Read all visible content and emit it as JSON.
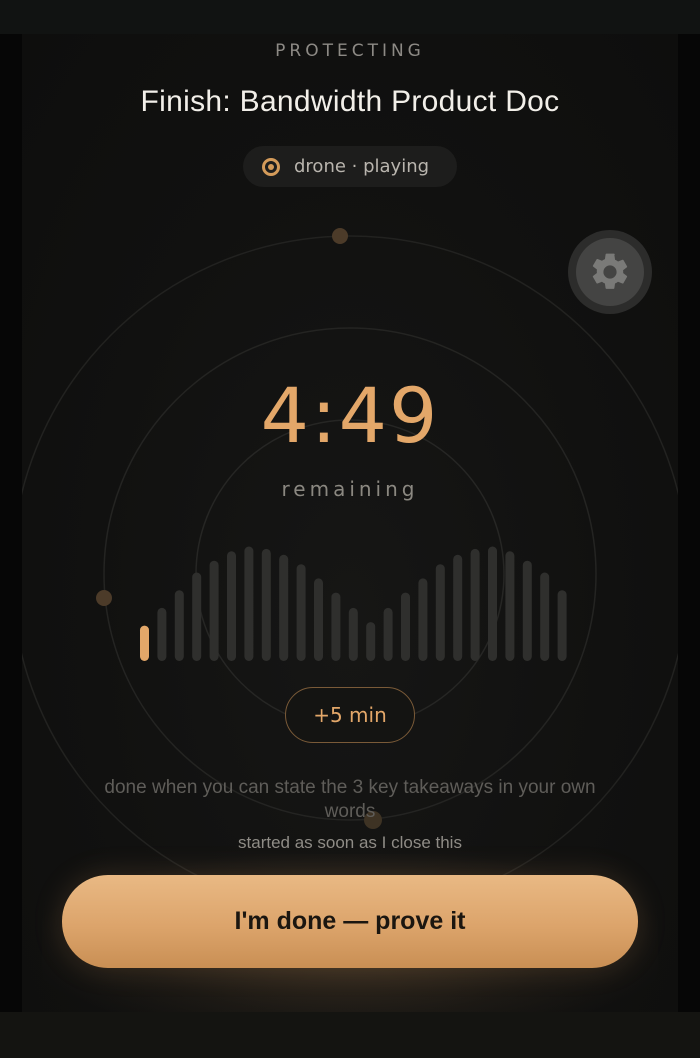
{
  "header": {
    "eyebrow": "PROTECTING",
    "task_title": "Finish: Bandwidth Product Doc"
  },
  "audio": {
    "status": "drone · playing",
    "icon": "radio-dot-icon"
  },
  "settings": {
    "icon": "gear-icon"
  },
  "timer": {
    "value": "4:49",
    "label": "remaining"
  },
  "waveform": {
    "bars": [
      0.3,
      0.45,
      0.6,
      0.75,
      0.85,
      0.93,
      0.97,
      0.95,
      0.9,
      0.82,
      0.7,
      0.58,
      0.45,
      0.33,
      0.45,
      0.58,
      0.7,
      0.82,
      0.9,
      0.95,
      0.97,
      0.93,
      0.85,
      0.75,
      0.6
    ],
    "progress_bars": 1
  },
  "actions": {
    "add_time_label": "+5 min",
    "done_label": "I'm done — prove it"
  },
  "criteria": {
    "done_when": "done when you can state the 3 key takeaways in your own words",
    "start_note": "started as soon as I close this"
  },
  "footer": {
    "partial_text": "· ·  · ·"
  },
  "colors": {
    "accent": "#e3a769",
    "background": "#111110"
  }
}
